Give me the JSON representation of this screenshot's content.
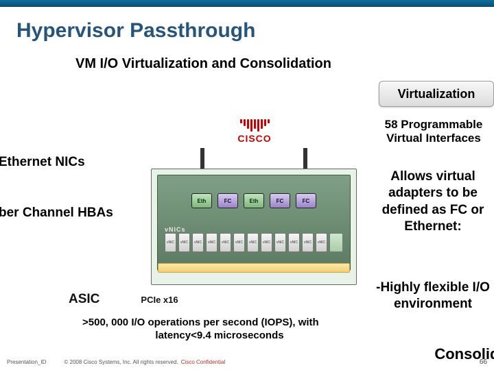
{
  "title": "Hypervisor Passthrough",
  "subtitle": "VM I/O Virtualization and Consolidation",
  "virt_button": "Virtualization",
  "right": {
    "programmable": "58 Programmable Virtual Interfaces",
    "allows": "Allows virtual adapters to be defined as FC or Ethernet:",
    "flex": "-Highly flexible I/O environment"
  },
  "left_labels": {
    "eth_nics": "Ethernet NICs",
    "fc_hbas": "ber Channel HBAs"
  },
  "diagram": {
    "ports": [
      {
        "type": "eth",
        "label": "Eth"
      },
      {
        "type": "fc",
        "label": "FC"
      },
      {
        "type": "eth",
        "label": "Eth"
      },
      {
        "type": "fc",
        "label": "FC"
      },
      {
        "type": "fc",
        "label": "FC"
      }
    ],
    "vnic_label": "vNICs",
    "vnic_text": "vNIC"
  },
  "cisco_word": "CISCO",
  "bottom": {
    "asic": "ASIC",
    "pcie": "PCIe x16"
  },
  "perf": {
    "line1": ">500, 000 I/O operations per second (IOPS), with",
    "line2": "latency<9.4 microseconds"
  },
  "footer": {
    "pid": "Presentation_ID",
    "copyright": "© 2008 Cisco Systems, Inc. All rights reserved.",
    "conf": "Cisco Confidential",
    "page": "66"
  },
  "cutoff": "Consolidation"
}
